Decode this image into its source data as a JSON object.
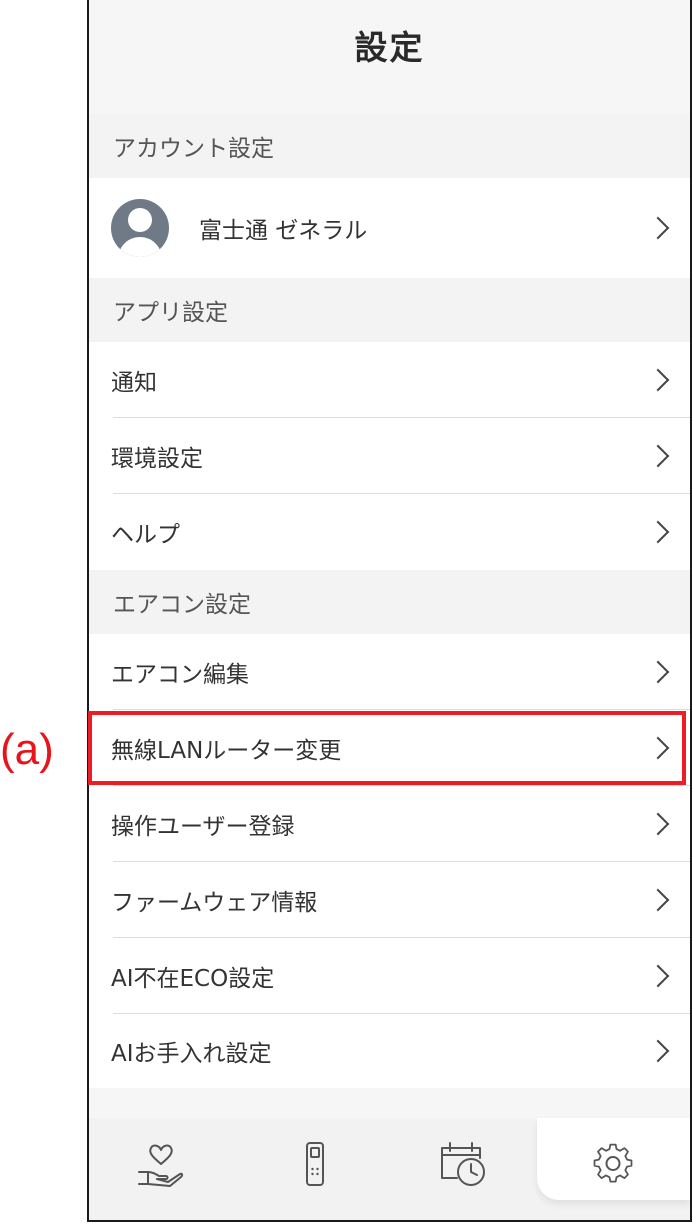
{
  "callout": {
    "label": "(a)"
  },
  "header": {
    "title": "設定"
  },
  "sections": {
    "account": {
      "title": "アカウント設定",
      "user_name": "富士通 ゼネラル"
    },
    "app": {
      "title": "アプリ設定",
      "items": [
        {
          "label": "通知"
        },
        {
          "label": "環境設定"
        },
        {
          "label": "ヘルプ"
        }
      ]
    },
    "aircon": {
      "title": "エアコン設定",
      "items": [
        {
          "label": "エアコン編集"
        },
        {
          "label": "無線LANルーター変更"
        },
        {
          "label": "操作ユーザー登録"
        },
        {
          "label": "ファームウェア情報"
        },
        {
          "label": "AI不在ECO設定"
        },
        {
          "label": "AIお手入れ設定"
        }
      ]
    }
  },
  "tabbar": {
    "tabs": [
      {
        "icon": "heart-hand-icon"
      },
      {
        "icon": "remote-control-icon"
      },
      {
        "icon": "calendar-clock-icon"
      },
      {
        "icon": "gear-icon",
        "active": true
      }
    ]
  },
  "colors": {
    "highlight": "#ee1c25",
    "background": "#f6f6f6"
  }
}
